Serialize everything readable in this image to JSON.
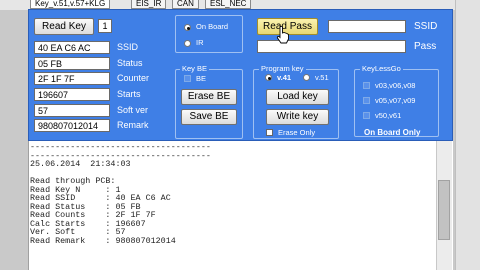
{
  "tabs": [
    {
      "label": "Key_v.51,v.57+KLG",
      "active": true
    },
    {
      "label": "EIS_IR",
      "active": false
    },
    {
      "label": "CAN",
      "active": false
    },
    {
      "label": "ESL_NEC",
      "active": false
    }
  ],
  "read_key": {
    "button": "Read Key",
    "number": "1"
  },
  "onboard_radio": {
    "on_board": "On Board",
    "ir": "IR",
    "selected": "On Board"
  },
  "fields": {
    "ssid": {
      "value": "40 EA C6 AC",
      "label": "SSID"
    },
    "status": {
      "value": "05 FB",
      "label": "Status"
    },
    "counter": {
      "value": "2F 1F 7F",
      "label": "Counter"
    },
    "starts": {
      "value": "196607",
      "label": "Starts"
    },
    "soft_ver": {
      "value": "57",
      "label": "Soft ver"
    },
    "remark": {
      "value": "980807012014",
      "label": "Remark"
    }
  },
  "key_be": {
    "title": "Key BE",
    "be_label": "BE",
    "erase": "Erase BE",
    "save": "Save BE"
  },
  "read_pass": {
    "button": "Read Pass",
    "ssid_label": "SSID",
    "pass_label": "Pass",
    "ssid_value": "",
    "pass_value": ""
  },
  "program_key": {
    "title": "Program key",
    "v41": "v.41",
    "v51": "v.51",
    "selected": "v.41",
    "load": "Load key",
    "write": "Write key",
    "erase_only": "Erase Only",
    "erase_only_checked": false
  },
  "keylessgo": {
    "title": "KeyLessGo",
    "options": [
      "v03,v06,v08",
      "v05,v07,v09",
      "v50,v61"
    ],
    "on_board_only": "On Board Only"
  },
  "log_lines": [
    "------------------------------------",
    "------------------------------------",
    "25.06.2014  21:34:03",
    "",
    "Read through PCB:",
    "Read Key N     : 1",
    "Read SSID      : 40 EA C6 AC",
    "Read Status    : 05 FB",
    "Read Counts    : 2F 1F 7F",
    "Calc Starts    : 196607",
    "Ver. Soft      : 57",
    "Read Remark    : 980807012014"
  ],
  "colors": {
    "panel": "#3f7fe6",
    "log_bg": "#ffffff",
    "button_highlight": "#f5e98a"
  }
}
